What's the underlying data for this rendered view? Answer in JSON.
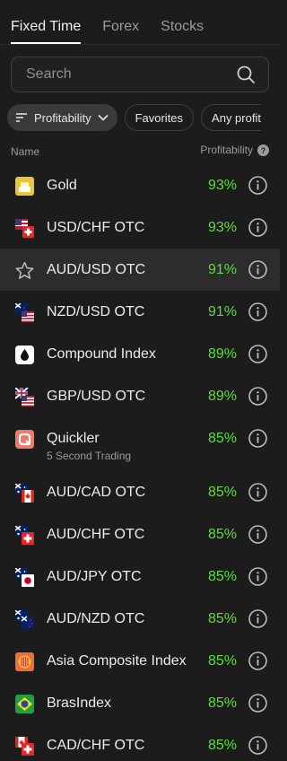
{
  "tabs": [
    {
      "label": "Fixed Time",
      "active": true
    },
    {
      "label": "Forex",
      "active": false
    },
    {
      "label": "Stocks",
      "active": false
    }
  ],
  "search": {
    "placeholder": "Search",
    "value": ""
  },
  "filters": {
    "sort_label": "Profitability",
    "favorites_label": "Favorites",
    "any_label": "Any profit"
  },
  "columns": {
    "name": "Name",
    "profitability": "Profitability"
  },
  "colors": {
    "accent_green": "#5fdc3f",
    "background": "#1c1c1c",
    "selected_row": "#2c2c2c"
  },
  "assets": [
    {
      "label": "Gold",
      "pct": "93%",
      "icon": "gold-icon"
    },
    {
      "label": "USD/CHF OTC",
      "pct": "93%",
      "icon": "flag-us-ch-icon"
    },
    {
      "label": "AUD/USD OTC",
      "pct": "91%",
      "icon": "star-icon",
      "selected": true
    },
    {
      "label": "NZD/USD OTC",
      "pct": "91%",
      "icon": "flag-nz-us-icon"
    },
    {
      "label": "Compound Index",
      "pct": "89%",
      "icon": "droplet-icon"
    },
    {
      "label": "GBP/USD OTC",
      "pct": "89%",
      "icon": "flag-gb-us-icon"
    },
    {
      "label": "Quickler",
      "sub": "5 Second Trading",
      "pct": "85%",
      "icon": "quickler-icon"
    },
    {
      "label": "AUD/CAD OTC",
      "pct": "85%",
      "icon": "flag-au-ca-icon"
    },
    {
      "label": "AUD/CHF OTC",
      "pct": "85%",
      "icon": "flag-au-ch-icon"
    },
    {
      "label": "AUD/JPY OTC",
      "pct": "85%",
      "icon": "flag-au-jp-icon"
    },
    {
      "label": "AUD/NZD OTC",
      "pct": "85%",
      "icon": "flag-au-nz-icon"
    },
    {
      "label": "Asia Composite Index",
      "pct": "85%",
      "icon": "asean-emblem-icon"
    },
    {
      "label": "BrasIndex",
      "pct": "85%",
      "icon": "flag-br-icon"
    },
    {
      "label": "CAD/CHF OTC",
      "pct": "85%",
      "icon": "flag-ca-ch-icon"
    }
  ]
}
